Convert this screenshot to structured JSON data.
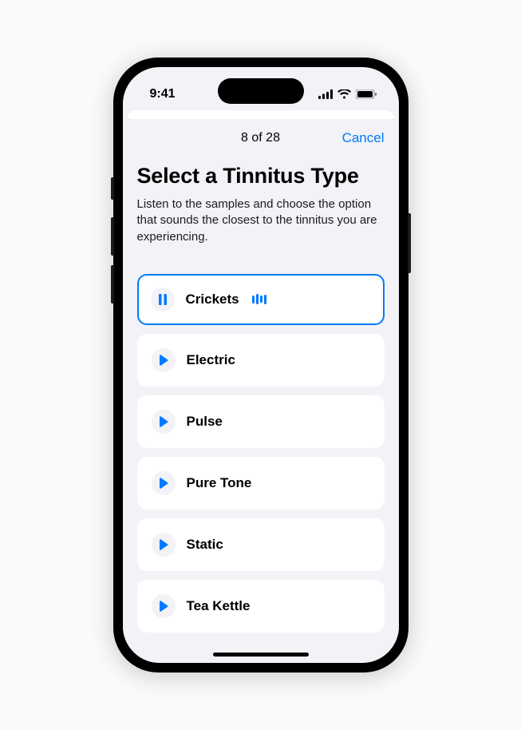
{
  "status": {
    "time": "9:41"
  },
  "sheet": {
    "page_indicator": "8 of 28",
    "cancel": "Cancel",
    "title": "Select a Tinnitus Type",
    "subtitle": "Listen to the samples and choose the option that sounds the closest to the tinnitus you are experiencing."
  },
  "options": [
    {
      "label": "Crickets",
      "playing": true
    },
    {
      "label": "Electric",
      "playing": false
    },
    {
      "label": "Pulse",
      "playing": false
    },
    {
      "label": "Pure Tone",
      "playing": false
    },
    {
      "label": "Static",
      "playing": false
    },
    {
      "label": "Tea Kettle",
      "playing": false
    }
  ],
  "colors": {
    "primary": "#007aff",
    "background": "#f2f2f7"
  }
}
